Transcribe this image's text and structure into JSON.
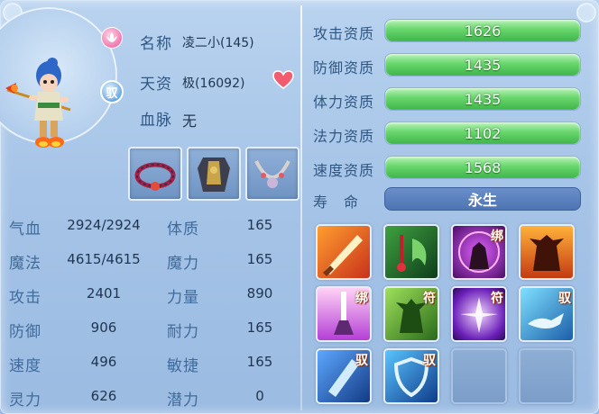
{
  "pet": {
    "name_label": "名称",
    "name_value": "凌二小(145)",
    "aptitude_label": "天资",
    "aptitude_value": "极(16092)",
    "bloodline_label": "血脉",
    "bloodline_value": "无",
    "rider_badge": "驭"
  },
  "icons": [
    "lotus-icon",
    "heart-icon",
    "rider-badge-icon"
  ],
  "equipment": [
    {
      "name": "red-bead-necklace"
    },
    {
      "name": "dark-armor"
    },
    {
      "name": "jeweled-necklace"
    }
  ],
  "stats": {
    "left": [
      {
        "label": "气血",
        "value": "2924/2924"
      },
      {
        "label": "魔法",
        "value": "4615/4615"
      },
      {
        "label": "攻击",
        "value": "2401"
      },
      {
        "label": "防御",
        "value": "906"
      },
      {
        "label": "速度",
        "value": "496"
      },
      {
        "label": "灵力",
        "value": "626"
      }
    ],
    "right": [
      {
        "label": "体质",
        "value": "165"
      },
      {
        "label": "魔力",
        "value": "165"
      },
      {
        "label": "力量",
        "value": "890"
      },
      {
        "label": "耐力",
        "value": "165"
      },
      {
        "label": "敏捷",
        "value": "165"
      },
      {
        "label": "潜力",
        "value": "0"
      }
    ]
  },
  "aptitudes": [
    {
      "label": "攻击资质",
      "value": "1626",
      "fill": 1.0
    },
    {
      "label": "防御资质",
      "value": "1435",
      "fill": 1.0
    },
    {
      "label": "体力资质",
      "value": "1435",
      "fill": 1.0
    },
    {
      "label": "法力资质",
      "value": "1102",
      "fill": 1.0
    },
    {
      "label": "速度资质",
      "value": "1568",
      "fill": 1.0
    }
  ],
  "lifespan": {
    "label": "寿　命",
    "value": "永生"
  },
  "skills": [
    {
      "name": "flame-sword-skill",
      "tag": ""
    },
    {
      "name": "blood-drop-skill",
      "tag": ""
    },
    {
      "name": "demon-summon-skill",
      "tag": "绑"
    },
    {
      "name": "demon-power-skill",
      "tag": ""
    },
    {
      "name": "holy-light-skill",
      "tag": "绑"
    },
    {
      "name": "green-demon-skill",
      "tag": "符"
    },
    {
      "name": "violet-burst-skill",
      "tag": "符"
    },
    {
      "name": "magic-lamp-skill",
      "tag": "驭"
    },
    {
      "name": "ice-blade-skill",
      "tag": "驭"
    },
    {
      "name": "shield-skill",
      "tag": "驭"
    },
    {
      "name": "empty-slot",
      "tag": ""
    },
    {
      "name": "empty-slot",
      "tag": ""
    }
  ],
  "colors": {
    "bar_green": "#4fc359",
    "bar_track": "#c2d6ee",
    "life_bar": "#5a80c0",
    "label_blue": "#2f5784"
  }
}
